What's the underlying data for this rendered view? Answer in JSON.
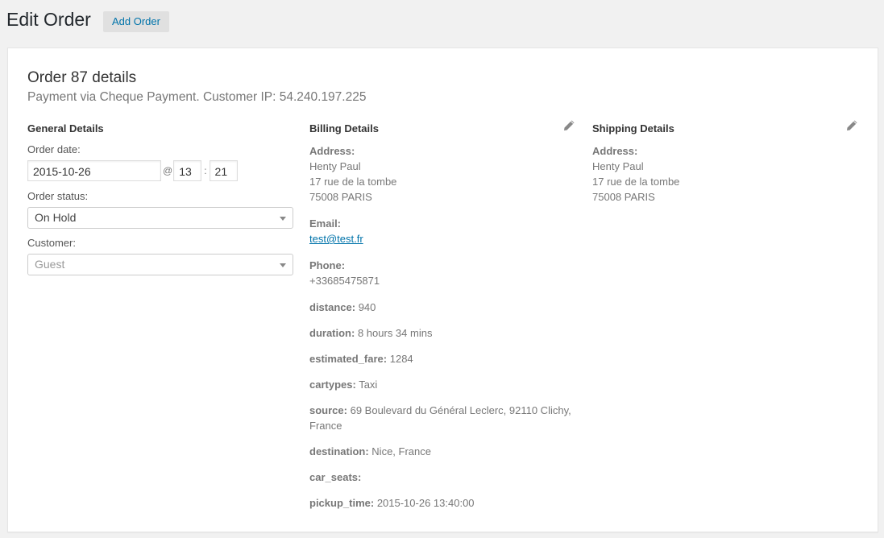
{
  "header": {
    "title": "Edit Order",
    "add_button": "Add Order"
  },
  "order": {
    "heading": "Order 87 details",
    "meta": "Payment via Cheque Payment. Customer IP: 54.240.197.225"
  },
  "general": {
    "title": "General Details",
    "order_date_label": "Order date:",
    "date": "2015-10-26",
    "at": "@",
    "hour": "13",
    "colon": ":",
    "minute": "21",
    "status_label": "Order status:",
    "status": "On Hold",
    "customer_label": "Customer:",
    "customer": "Guest"
  },
  "billing": {
    "title": "Billing Details",
    "address_label": "Address:",
    "address": [
      "Henty Paul",
      "17 rue de la tombe",
      "75008 PARIS"
    ],
    "email_label": "Email:",
    "email": "test@test.fr",
    "phone_label": "Phone:",
    "phone": "+33685475871",
    "fields": [
      {
        "key": "distance:",
        "value": "940"
      },
      {
        "key": "duration:",
        "value": "8 hours 34 mins"
      },
      {
        "key": "estimated_fare:",
        "value": "1284"
      },
      {
        "key": "cartypes:",
        "value": "Taxi"
      },
      {
        "key": "source:",
        "value": "69 Boulevard du Général Leclerc, 92110 Clichy, France"
      },
      {
        "key": "destination:",
        "value": "Nice, France"
      },
      {
        "key": "car_seats:",
        "value": ""
      },
      {
        "key": "pickup_time:",
        "value": "2015-10-26 13:40:00"
      }
    ]
  },
  "shipping": {
    "title": "Shipping Details",
    "address_label": "Address:",
    "address": [
      "Henty Paul",
      "17 rue de la tombe",
      "75008 PARIS"
    ]
  },
  "icons": {
    "edit": "pencil-icon",
    "dropdown": "caret-down-icon"
  },
  "colors": {
    "link": "#0073aa",
    "background": "#f1f1f1"
  }
}
